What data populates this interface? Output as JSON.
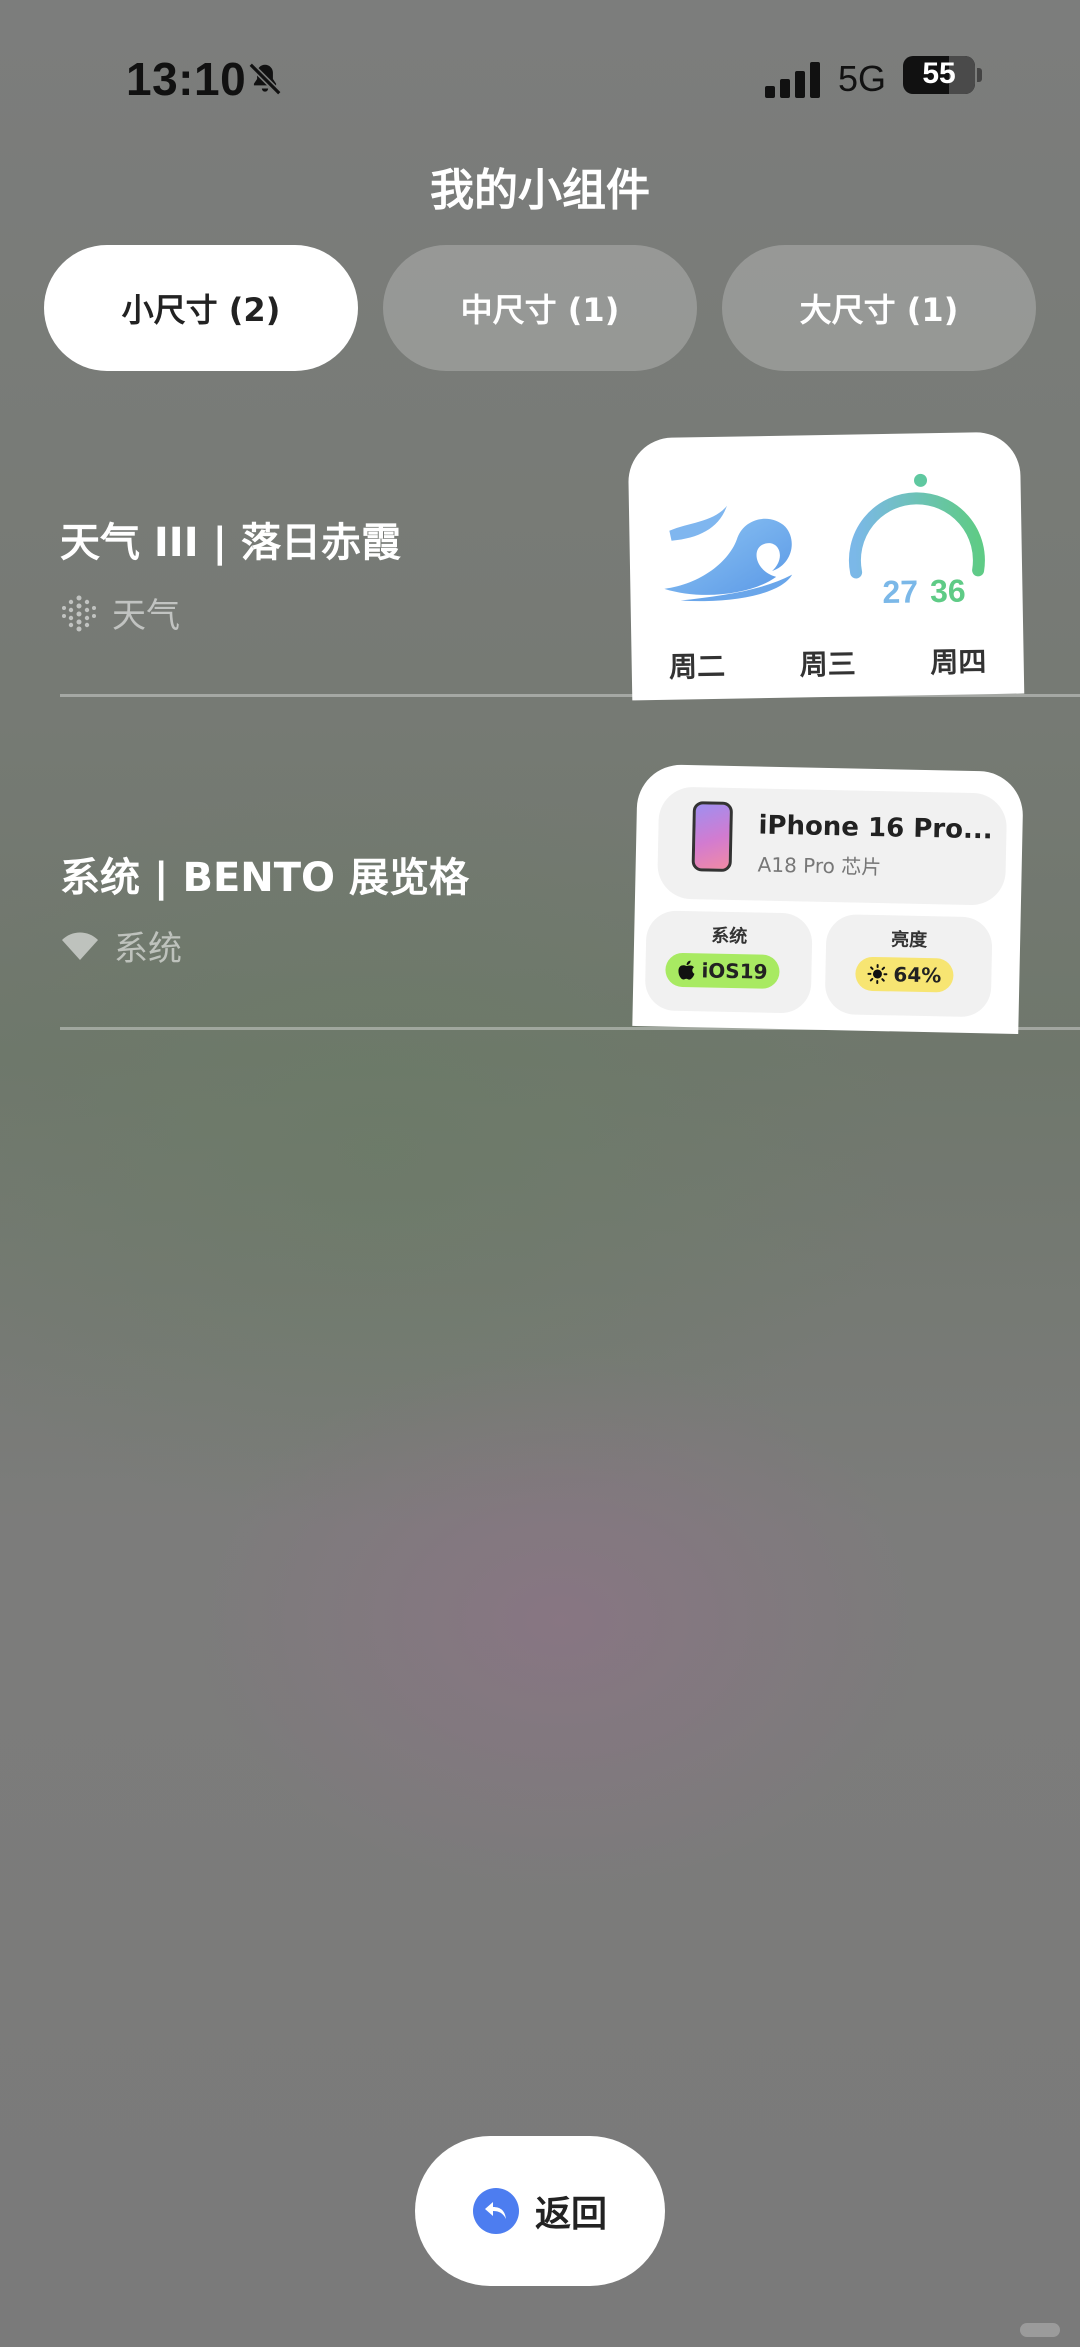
{
  "status_bar": {
    "time": "13:10",
    "network": "5G",
    "battery": "55",
    "battery_level_percent": 55
  },
  "page": {
    "title": "我的小组件"
  },
  "tabs": [
    {
      "label": "小尺寸 (2)",
      "active": true
    },
    {
      "label": "中尺寸 (1)",
      "active": false
    },
    {
      "label": "大尺寸 (1)",
      "active": false
    }
  ],
  "widgets": [
    {
      "title": "天气 III | 落日赤霞",
      "category": "天气",
      "category_icon": "weather-dots-icon",
      "preview": {
        "temp_low": "27",
        "temp_high": "36",
        "days": [
          "周二",
          "周三",
          "周四"
        ]
      }
    },
    {
      "title": "系统 | BENTO 展览格",
      "category": "系统",
      "category_icon": "wifi-icon",
      "preview": {
        "device_name": "iPhone 16 Pro...",
        "chip": "A18 Pro 芯片",
        "system_label": "系统",
        "system_value": "iOS19",
        "brightness_label": "亮度",
        "brightness_value": "64%"
      }
    }
  ],
  "footer": {
    "back_label": "返回"
  },
  "colors": {
    "active_tab_bg": "#ffffff",
    "back_icon_bg": "#4d7df0",
    "temp_low": "#7bb8e8",
    "temp_high": "#5fcb86",
    "ios_pill": "#a8ea62",
    "brightness_pill": "#f7e572"
  }
}
